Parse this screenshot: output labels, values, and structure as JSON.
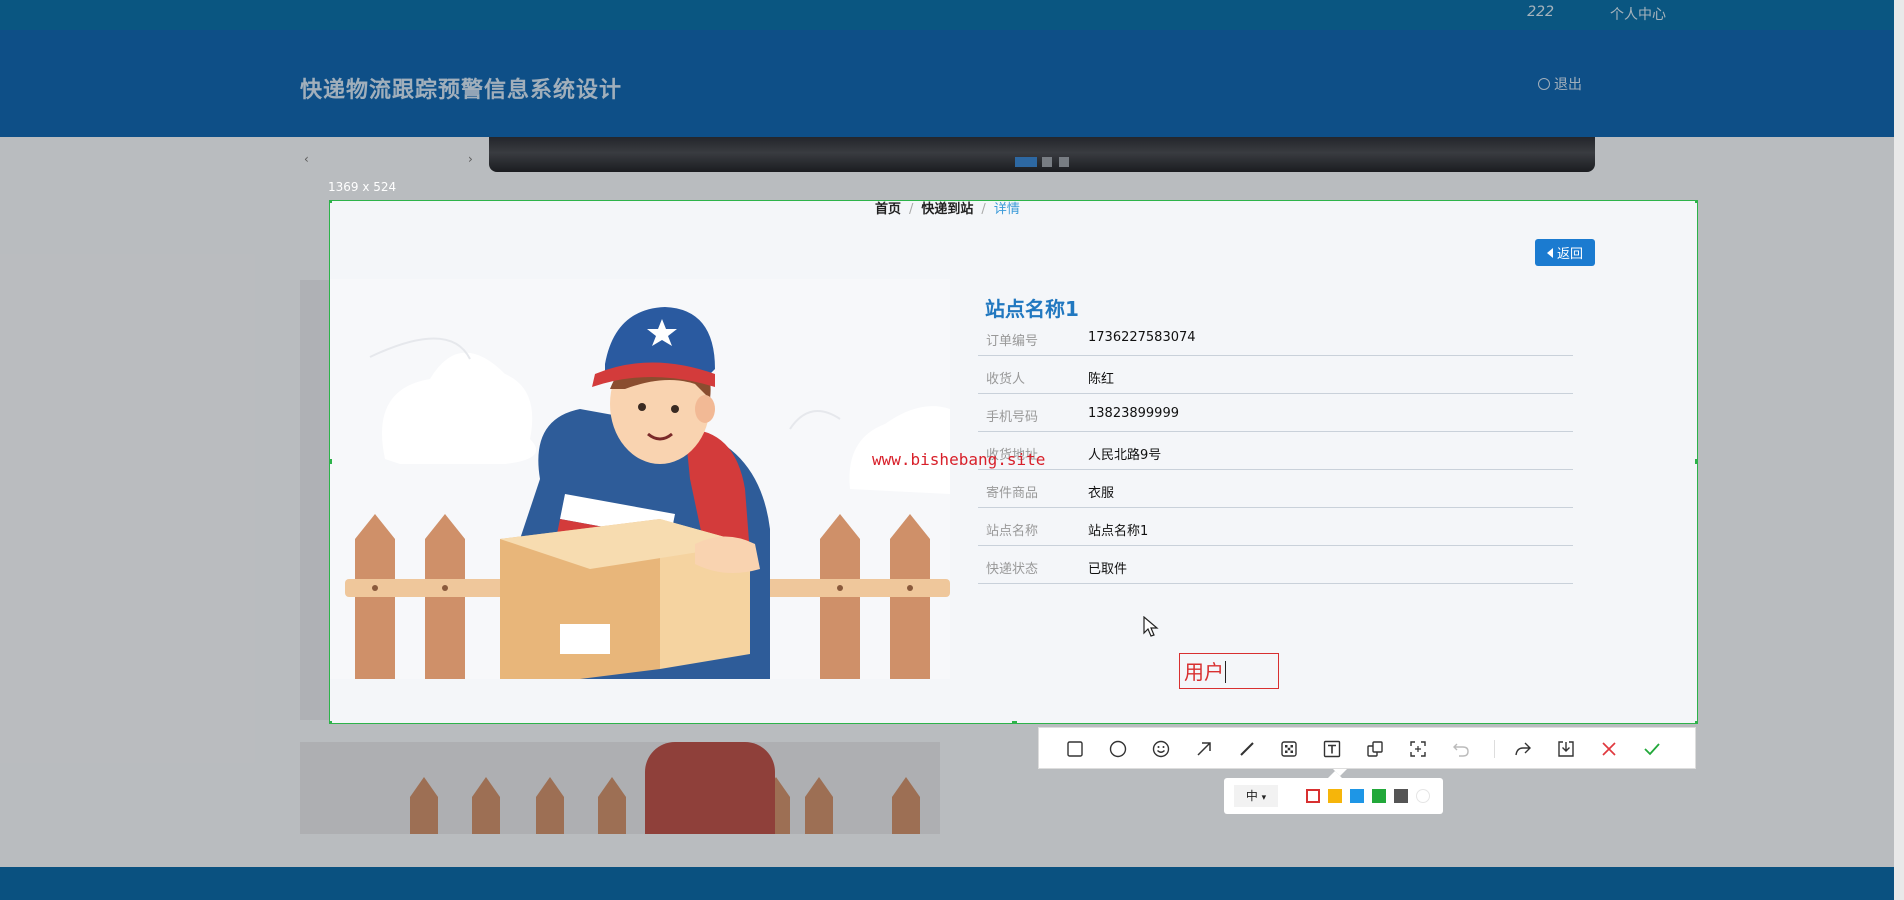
{
  "topbar": {
    "user": "222",
    "personal_center": "个人中心"
  },
  "header": {
    "title": "快递物流跟踪预警信息系统设计",
    "logout": "退出"
  },
  "screenshot": {
    "size_label": "1369 x 524"
  },
  "breadcrumb": {
    "home": "首页",
    "sep": "/",
    "section": "快递到站",
    "current": "详情"
  },
  "back_button": "返回",
  "detail": {
    "title": "站点名称1",
    "fields": [
      {
        "label": "订单编号",
        "value": "1736227583074"
      },
      {
        "label": "收货人",
        "value": "陈红"
      },
      {
        "label": "手机号码",
        "value": "13823899999"
      },
      {
        "label": "收货地址",
        "value": "人民北路9号"
      },
      {
        "label": "寄件商品",
        "value": "衣服"
      },
      {
        "label": "站点名称",
        "value": "站点名称1"
      },
      {
        "label": "快递状态",
        "value": "已取件"
      }
    ]
  },
  "watermark": "www.bishebang.site",
  "annotation_text": "用户",
  "toolbar": {
    "tools": [
      "rectangle-icon",
      "ellipse-icon",
      "emoji-icon",
      "arrow-icon",
      "pen-icon",
      "mosaic-icon",
      "text-icon",
      "pin-icon",
      "ocr-icon",
      "undo-icon",
      "share-icon",
      "download-icon",
      "close-icon",
      "confirm-icon"
    ],
    "size_option": "中",
    "colors": [
      "#d83030",
      "#f6b50a",
      "#1e96e6",
      "#22a83a",
      "#555555",
      "#ffffff"
    ],
    "selected_color": "#d83030"
  }
}
